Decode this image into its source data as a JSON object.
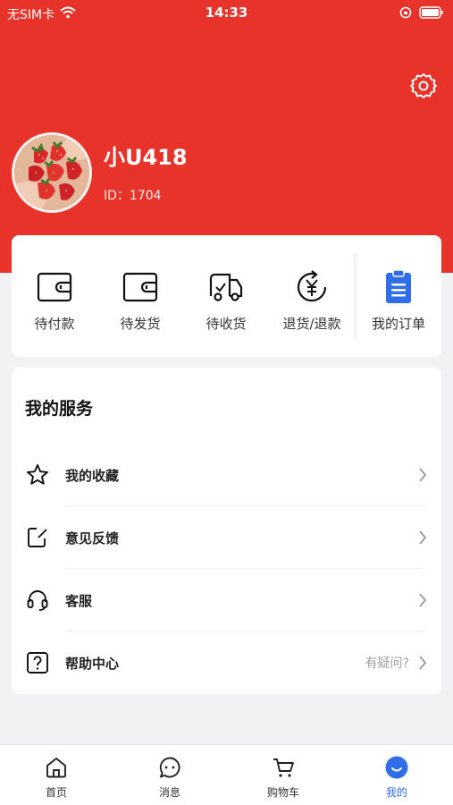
{
  "status_bar": {
    "carrier": "无SIM卡",
    "time": "14:33"
  },
  "profile": {
    "username": "小U418",
    "id_label": "ID：",
    "id_value": "1704"
  },
  "orders": [
    {
      "label": "待付款",
      "icon": "wallet-icon"
    },
    {
      "label": "待发货",
      "icon": "wallet-icon"
    },
    {
      "label": "待收货",
      "icon": "truck-icon"
    },
    {
      "label": "退货/退款",
      "icon": "refund-icon"
    },
    {
      "label": "我的订单",
      "icon": "clipboard-icon"
    }
  ],
  "services": {
    "title": "我的服务",
    "items": [
      {
        "label": "我的收藏",
        "icon": "star-icon",
        "hint": ""
      },
      {
        "label": "意见反馈",
        "icon": "edit-icon",
        "hint": ""
      },
      {
        "label": "客服",
        "icon": "headset-icon",
        "hint": ""
      },
      {
        "label": "帮助中心",
        "icon": "help-icon",
        "hint": "有疑问?"
      }
    ]
  },
  "tabbar": {
    "items": [
      {
        "label": "首页",
        "icon": "home-icon"
      },
      {
        "label": "消息",
        "icon": "chat-icon"
      },
      {
        "label": "购物车",
        "icon": "cart-icon"
      },
      {
        "label": "我的",
        "icon": "profile-icon",
        "active": true
      }
    ]
  },
  "colors": {
    "brand_red": "#e8332a",
    "accent_blue": "#2f6ee8"
  }
}
